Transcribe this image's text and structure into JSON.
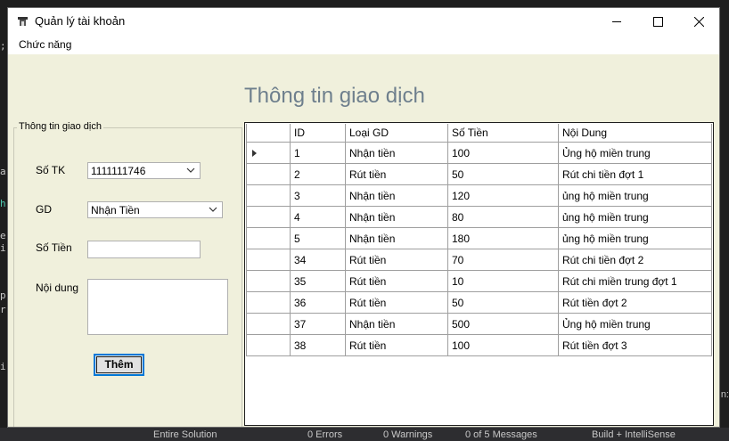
{
  "window": {
    "title": "Quản lý tài khoản"
  },
  "menu": {
    "items": [
      "Chức năng"
    ]
  },
  "page": {
    "heading": "Thông tin giao dịch"
  },
  "form": {
    "group_title": "Thông tin giao dịch",
    "account_label": "Số TK",
    "account_value": "1111111746",
    "type_label": "GD",
    "type_value": "Nhận Tiền",
    "amount_label": "Số Tiền",
    "amount_value": "",
    "content_label": "Nội dung",
    "content_value": "",
    "submit_label": "Thêm"
  },
  "grid": {
    "columns": [
      "ID",
      "Loại GD",
      "Số Tiền",
      "Nội Dung"
    ],
    "rows": [
      [
        "1",
        "Nhận tiền",
        "100",
        "Ủng hộ miền trung"
      ],
      [
        "2",
        "Rút tiền",
        "50",
        "Rút chi tiền đợt 1"
      ],
      [
        "3",
        "Nhận tiền",
        "120",
        "ủng hộ miền trung"
      ],
      [
        "4",
        "Nhận tiền",
        "80",
        "ủng hộ miền trung"
      ],
      [
        "5",
        "Nhận tiền",
        "180",
        "ủng hộ miền trung"
      ],
      [
        "34",
        "Rút tiền",
        "70",
        "Rút chi tiền đợt 2"
      ],
      [
        "35",
        "Rút tiền",
        "10",
        "Rút chi miền trung đợt 1"
      ],
      [
        "36",
        "Rút tiền",
        "50",
        "Rút tiền đợt 2"
      ],
      [
        "37",
        "Nhận tiền",
        "500",
        "Ủng hộ miền trung"
      ],
      [
        "38",
        "Rút tiền",
        "100",
        "Rút tiền đợt 3"
      ]
    ]
  },
  "background": {
    "status_items": [
      "Entire Solution",
      "0 Errors",
      "0 Warnings",
      "0 of 5 Messages",
      "Build + IntelliSense"
    ],
    "left_glyphs": [
      ";",
      "a",
      "h",
      "e",
      "i",
      "p",
      "r",
      "i"
    ],
    "right_glyph": "n:"
  },
  "colors": {
    "window_bg": "#f0f0dc",
    "heading": "#6e7f8d",
    "focus": "#0078d7"
  }
}
